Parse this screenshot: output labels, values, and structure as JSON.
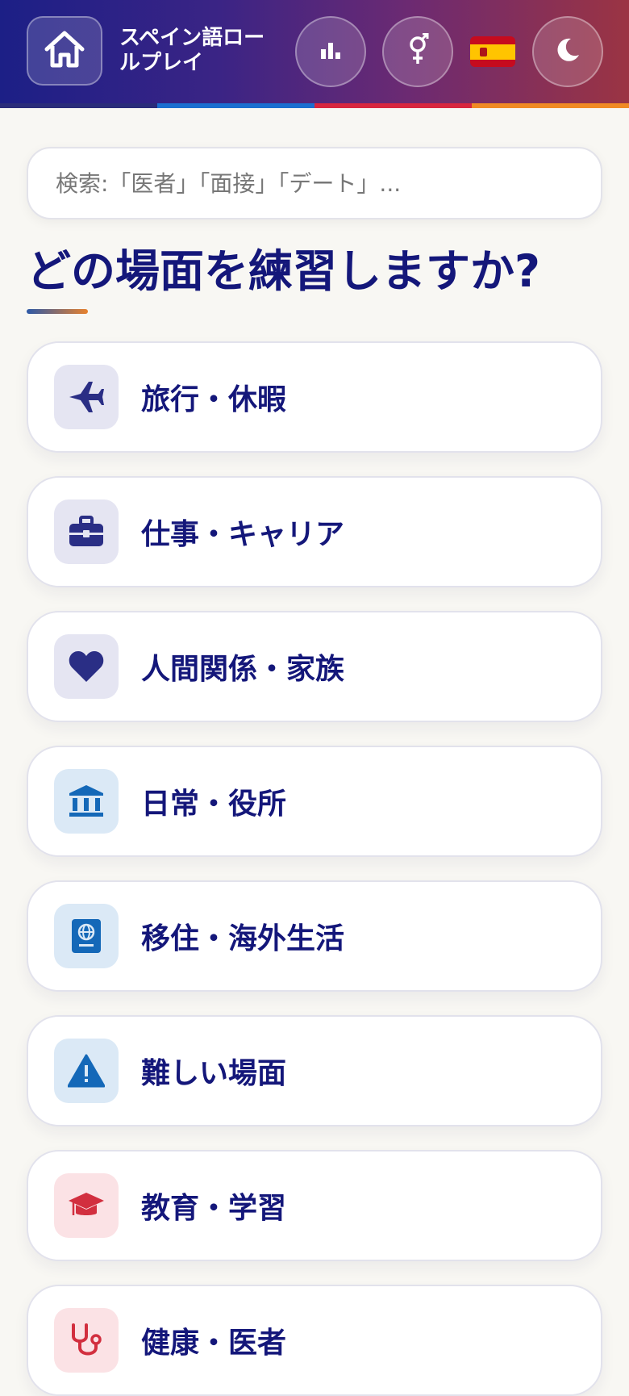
{
  "header": {
    "title": "スペイン語ロールプレイ",
    "home_icon": "home-icon",
    "stats_icon": "bar-chart-icon",
    "gender_icon": "gender-icon",
    "flag": "spain-flag",
    "theme_icon": "moon-icon",
    "stripe_colors": [
      "#2a2c7a",
      "#1b6fd0",
      "#d8263f",
      "#f08a24"
    ]
  },
  "search": {
    "placeholder": "検索:「医者」「面接」「デート」..."
  },
  "heading": "どの場面を練習しますか?",
  "categories": [
    {
      "label": "旅行・休暇",
      "icon": "airplane-icon",
      "tone": "#e5e5f2",
      "color": "#2a2e85"
    },
    {
      "label": "仕事・キャリア",
      "icon": "briefcase-icon",
      "tone": "#e5e5f2",
      "color": "#2a2e85"
    },
    {
      "label": "人間関係・家族",
      "icon": "heart-icon",
      "tone": "#e5e5f2",
      "color": "#2a2e85"
    },
    {
      "label": "日常・役所",
      "icon": "landmark-icon",
      "tone": "#dbe9f6",
      "color": "#1468b8"
    },
    {
      "label": "移住・海外生活",
      "icon": "passport-icon",
      "tone": "#dbe9f6",
      "color": "#1468b8"
    },
    {
      "label": "難しい場面",
      "icon": "warning-icon",
      "tone": "#dbe9f6",
      "color": "#1468b8"
    },
    {
      "label": "教育・学習",
      "icon": "graduation-cap-icon",
      "tone": "#fbe2e5",
      "color": "#d22f3f"
    },
    {
      "label": "健康・医者",
      "icon": "stethoscope-icon",
      "tone": "#fbe2e5",
      "color": "#d22f3f"
    }
  ]
}
